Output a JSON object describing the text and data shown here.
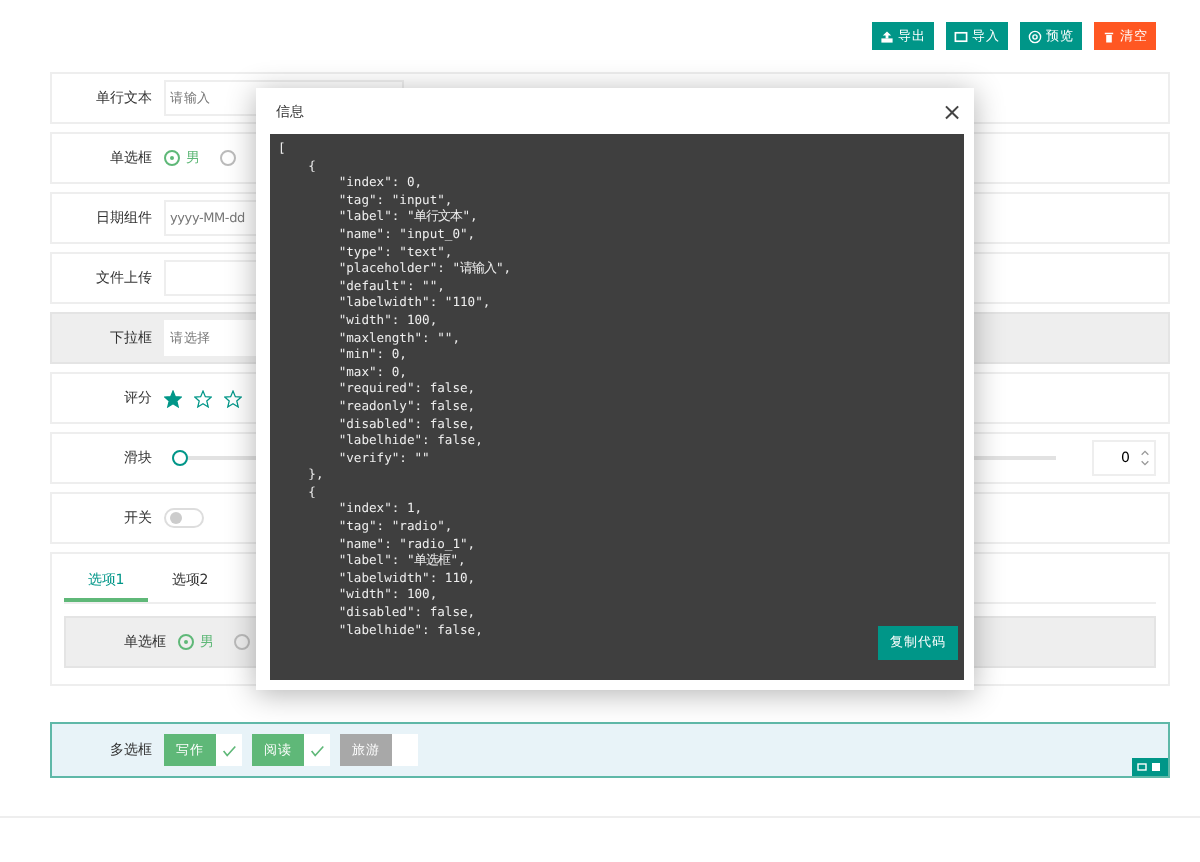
{
  "toolbar": [
    {
      "label": "导出",
      "kind": "export",
      "color": "#009688"
    },
    {
      "label": "导入",
      "kind": "import",
      "color": "#009688"
    },
    {
      "label": "预览",
      "kind": "preview",
      "color": "#009688"
    },
    {
      "label": "清空",
      "kind": "clear",
      "color": "#ff5722"
    }
  ],
  "fields": [
    {
      "kind": "input",
      "label": "单行文本",
      "placeholder": "请输入",
      "selected": false,
      "shaded": false
    },
    {
      "kind": "radio",
      "label": "单选框",
      "options": [
        {
          "label": "男",
          "selected": true
        },
        {
          "selected": false
        }
      ],
      "selected": false,
      "shaded": false
    },
    {
      "kind": "input",
      "label": "日期组件",
      "placeholder": "yyyy-MM-dd",
      "selected": false,
      "shaded": false
    },
    {
      "kind": "upload",
      "label": "文件上传",
      "selected": false,
      "shaded": false
    },
    {
      "kind": "input",
      "label": "下拉框",
      "placeholder": "请选择",
      "selected": false,
      "shaded": true
    },
    {
      "kind": "rate",
      "label": "评分",
      "stars": 1,
      "selected": false,
      "shaded": false
    },
    {
      "kind": "slider",
      "label": "滑块",
      "level": 0,
      "reading": "0",
      "selected": false,
      "shaded": false
    },
    {
      "kind": "switch",
      "label": "开关",
      "on": false,
      "selected": false,
      "shaded": false
    },
    {
      "kind": "tabs",
      "tabs": [
        {
          "label": "选项1",
          "selected": true
        },
        {
          "label": "选项2",
          "selected": false
        }
      ],
      "inner": {
        "label": "单选框",
        "options": [
          {
            "label": "男",
            "selected": true
          },
          {
            "selected": false
          }
        ]
      },
      "selected": false,
      "shaded": false
    },
    {
      "kind": "checkbox",
      "label": "多选框",
      "options": [
        {
          "label": "写作",
          "checked": true
        },
        {
          "label": "阅读",
          "checked": true
        },
        {
          "label": "旅游",
          "checked": false
        }
      ],
      "selected": true,
      "shaded": false
    }
  ],
  "dialog": {
    "title": "信息",
    "close": "×",
    "button": "复制代码",
    "code_lines": [
      "[",
      "    {",
      "        \"index\": 0,",
      "        \"tag\": \"input\",",
      "        \"label\": \"单行文本\",",
      "        \"name\": \"input_0\",",
      "        \"type\": \"text\",",
      "        \"placeholder\": \"请输入\",",
      "        \"default\": \"\",",
      "        \"labelwidth\": \"110\",",
      "        \"width\": 100,",
      "        \"maxlength\": \"\",",
      "        \"min\": 0,",
      "        \"max\": 0,",
      "        \"required\": false,",
      "        \"readonly\": false,",
      "        \"disabled\": false,",
      "        \"labelhide\": false,",
      "        \"verify\": \"\"",
      "    },",
      "    {",
      "        \"index\": 1,",
      "        \"tag\": \"radio\",",
      "        \"name\": \"radio_1\",",
      "        \"label\": \"单选框\",",
      "        \"labelwidth\": 110,",
      "        \"width\": 100,",
      "        \"disabled\": false,",
      "        \"labelhide\": false,"
    ]
  }
}
